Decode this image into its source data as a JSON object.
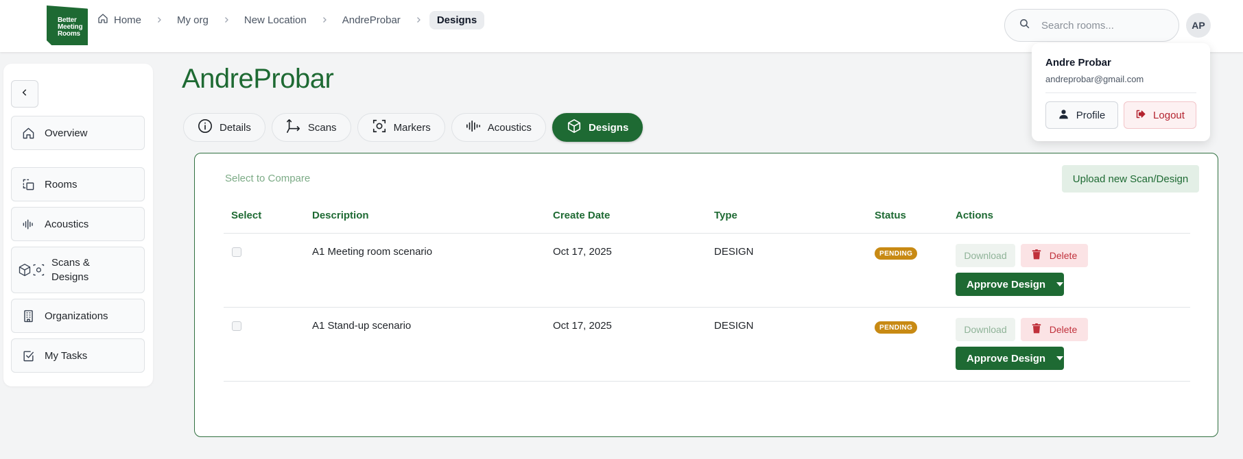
{
  "brand": {
    "logo_lines": [
      "Better",
      "Meeting",
      "Rooms"
    ]
  },
  "breadcrumb": [
    {
      "label": "Home",
      "icon": "home-icon"
    },
    {
      "label": "My org"
    },
    {
      "label": "New Location"
    },
    {
      "label": "AndreProbar"
    },
    {
      "label": "Designs",
      "current": true
    }
  ],
  "search": {
    "placeholder": "Search rooms...",
    "value": ""
  },
  "user": {
    "initials": "AP",
    "name": "Andre Probar",
    "email": "andreprobar@gmail.com",
    "profile_label": "Profile",
    "logout_label": "Logout"
  },
  "sidebar": {
    "items": [
      {
        "label": "Overview",
        "icon": "home-icon"
      },
      {
        "label": "Rooms",
        "icon": "rooms-icon"
      },
      {
        "label": "Acoustics",
        "icon": "waveform-icon"
      },
      {
        "label": "Scans & Designs",
        "icon": "cube-scan-icon"
      },
      {
        "label": "Organizations",
        "icon": "building-icon"
      },
      {
        "label": "My Tasks",
        "icon": "checkbox-icon"
      }
    ]
  },
  "page": {
    "title": "AndreProbar"
  },
  "tabs": [
    {
      "label": "Details",
      "icon": "info-icon"
    },
    {
      "label": "Scans",
      "icon": "axes-icon"
    },
    {
      "label": "Markers",
      "icon": "scan-marker-icon"
    },
    {
      "label": "Acoustics",
      "icon": "waveform-icon"
    },
    {
      "label": "Designs",
      "icon": "cube-icon",
      "active": true
    }
  ],
  "panel": {
    "compare_label": "Select to Compare",
    "upload_label": "Upload new Scan/Design",
    "columns": [
      "Select",
      "Description",
      "Create Date",
      "Type",
      "Status",
      "Actions"
    ],
    "rows": [
      {
        "description": "A1 Meeting room scenario",
        "date": "Oct 17, 2025",
        "type": "DESIGN",
        "status": "PENDING"
      },
      {
        "description": "A1 Stand-up scenario",
        "date": "Oct 17, 2025",
        "type": "DESIGN",
        "status": "PENDING"
      }
    ],
    "actions": {
      "download": "Download",
      "delete": "Delete",
      "approve": "Approve Design"
    }
  },
  "colors": {
    "brand_green": "#1e6a33",
    "pending": "#c88a14",
    "danger": "#c0303b"
  }
}
